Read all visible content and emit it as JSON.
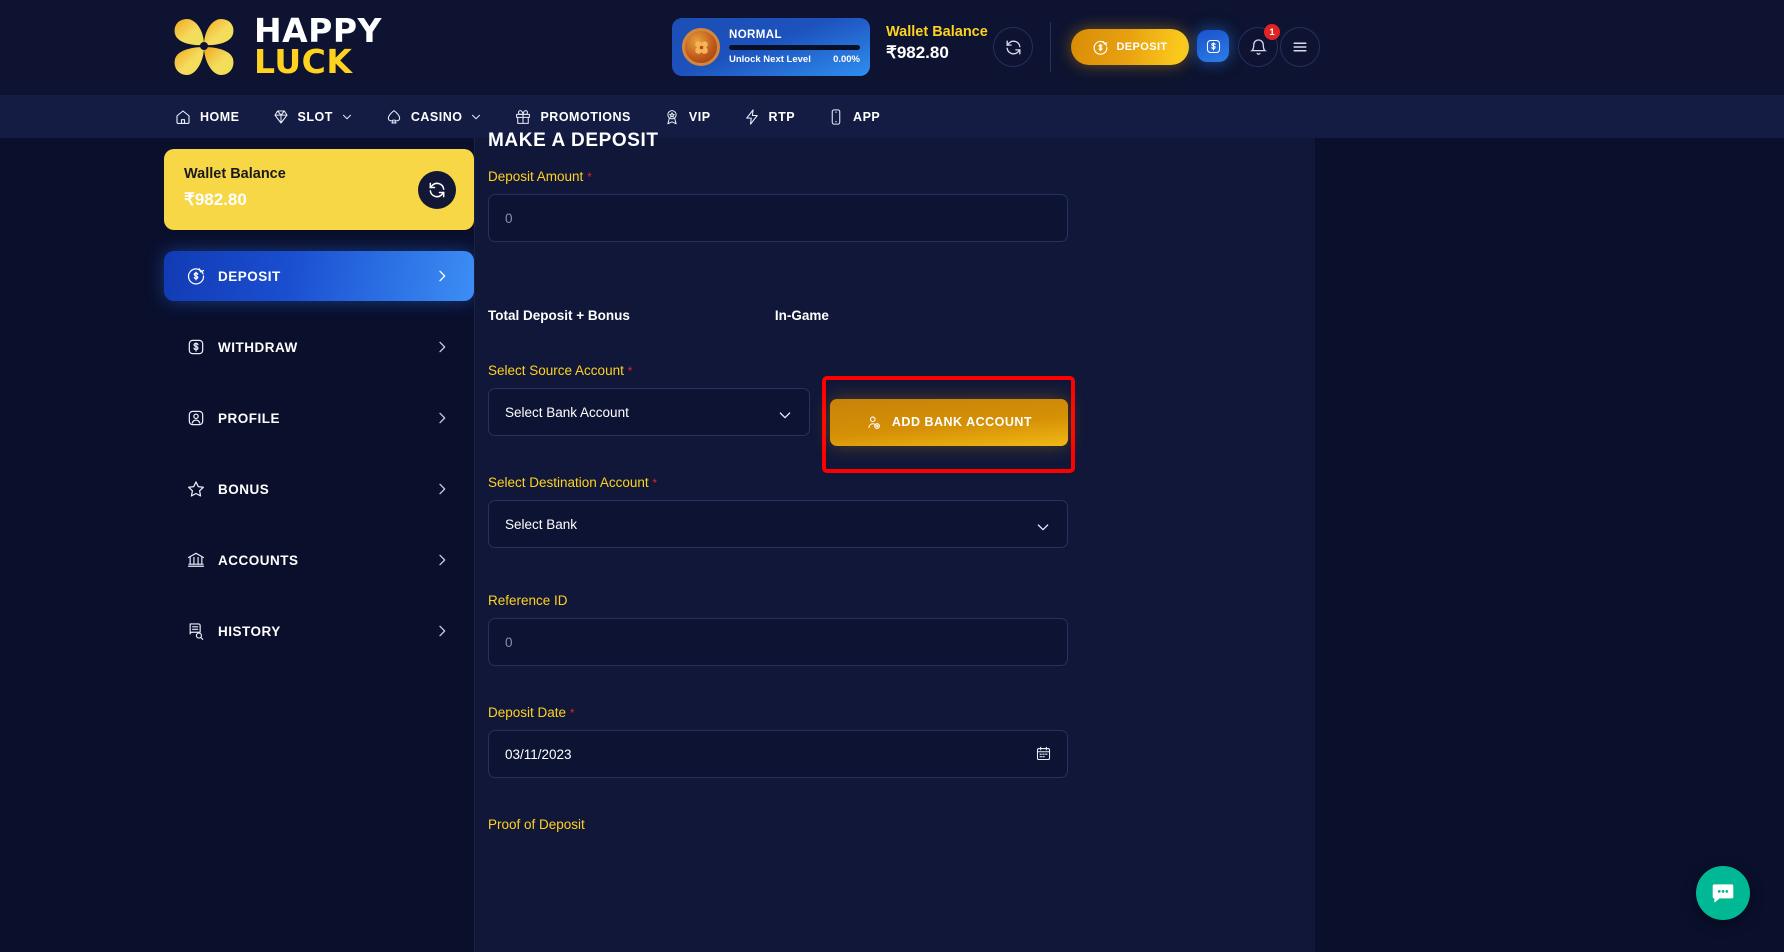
{
  "brand": {
    "name_line1": "HAPPY",
    "name_line2": "LUCK"
  },
  "header": {
    "vip": {
      "level": "NORMAL",
      "unlock_label": "Unlock Next Level",
      "progress_percent": "0.00%",
      "progress_value": 0
    },
    "wallet_label": "Wallet Balance",
    "wallet_amount": "₹982.80",
    "deposit_button": "DEPOSIT",
    "notification_count": "1"
  },
  "nav": {
    "items": [
      {
        "label": "HOME",
        "icon": "home-icon",
        "has_chevron": false
      },
      {
        "label": "SLOT",
        "icon": "diamond-icon",
        "has_chevron": true
      },
      {
        "label": "CASINO",
        "icon": "spade-icon",
        "has_chevron": true
      },
      {
        "label": "PROMOTIONS",
        "icon": "gift-icon",
        "has_chevron": false
      },
      {
        "label": "VIP",
        "icon": "vip-badge-icon",
        "has_chevron": false
      },
      {
        "label": "RTP",
        "icon": "lightning-icon",
        "has_chevron": false
      },
      {
        "label": "APP",
        "icon": "mobile-icon",
        "has_chevron": false
      }
    ]
  },
  "sidebar": {
    "wallet_card": {
      "label": "Wallet Balance",
      "amount": "₹982.80"
    },
    "items": [
      {
        "label": "DEPOSIT",
        "icon": "deposit-coin-icon",
        "active": true
      },
      {
        "label": "WITHDRAW",
        "icon": "dollar-box-icon",
        "active": false
      },
      {
        "label": "PROFILE",
        "icon": "user-box-icon",
        "active": false
      },
      {
        "label": "BONUS",
        "icon": "star-icon",
        "active": false
      },
      {
        "label": "ACCOUNTS",
        "icon": "bank-icon",
        "active": false
      },
      {
        "label": "HISTORY",
        "icon": "document-search-icon",
        "active": false
      }
    ]
  },
  "main": {
    "title": "MAKE A DEPOSIT",
    "deposit_amount": {
      "label": "Deposit Amount",
      "required": "*",
      "placeholder": "0",
      "value": ""
    },
    "summary": {
      "total_label": "Total Deposit + Bonus",
      "ingame_label": "In-Game"
    },
    "source_account": {
      "label": "Select Source Account",
      "required": "*",
      "selected": "Select Bank Account"
    },
    "add_bank_button": "ADD BANK ACCOUNT",
    "destination_account": {
      "label": "Select Destination Account",
      "required": "*",
      "selected": "Select Bank"
    },
    "reference_id": {
      "label": "Reference ID",
      "placeholder": "0",
      "value": ""
    },
    "deposit_date": {
      "label": "Deposit Date",
      "required": "*",
      "value": "03/11/2023"
    },
    "proof_of_deposit": {
      "label": "Proof of Deposit"
    }
  },
  "colors": {
    "accent_gold": "#ffd21f",
    "accent_blue": "#1a4ed0",
    "highlight_red": "#ff0000",
    "page_bg": "#0a0f2c",
    "panel_bg": "#101738",
    "chat_green": "#00b894"
  }
}
